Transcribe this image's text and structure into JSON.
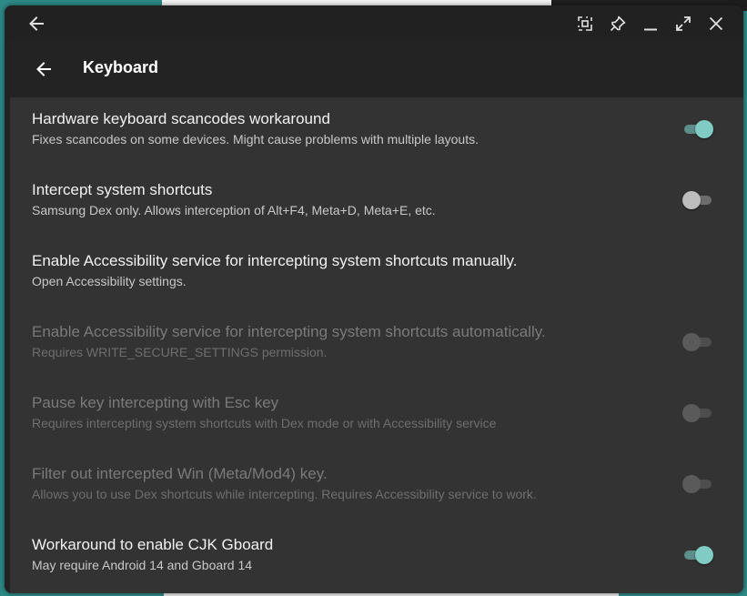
{
  "window": {
    "caption_buttons": [
      {
        "icon": "arrow-back-icon"
      },
      {
        "icon": "screenshot-select-icon"
      },
      {
        "icon": "pin-icon"
      },
      {
        "icon": "minimize-icon"
      },
      {
        "icon": "maximize-icon"
      },
      {
        "icon": "close-icon"
      }
    ]
  },
  "appbar": {
    "back_icon": "arrow-back-icon",
    "title": "Keyboard"
  },
  "colors": {
    "accent": "#80cbc4",
    "background": "#333333",
    "appbar": "#232323"
  },
  "settings": [
    {
      "title": "Hardware keyboard scancodes workaround",
      "subtitle": "Fixes scancodes on some devices. Might cause problems with multiple layouts.",
      "toggle": "on",
      "enabled": true
    },
    {
      "title": "Intercept system shortcuts",
      "subtitle": "Samsung Dex only. Allows interception of Alt+F4, Meta+D, Meta+E, etc.",
      "toggle": "off",
      "enabled": true
    },
    {
      "title": "Enable Accessibility service for intercepting system shortcuts manually.",
      "subtitle": "Open Accessibility settings.",
      "toggle": null,
      "enabled": true
    },
    {
      "title": "Enable Accessibility service for intercepting system shortcuts automatically.",
      "subtitle": "Requires WRITE_SECURE_SETTINGS permission.",
      "toggle": "off",
      "enabled": false
    },
    {
      "title": "Pause key intercepting with Esc key",
      "subtitle": "Requires intercepting system shortcuts with Dex mode or with Accessibility service",
      "toggle": "off",
      "enabled": false
    },
    {
      "title": "Filter out intercepted Win (Meta/Mod4) key.",
      "subtitle": "Allows you to use Dex shortcuts while intercepting. Requires Accessibility service to work.",
      "toggle": "off",
      "enabled": false
    },
    {
      "title": "Workaround to enable CJK Gboard",
      "subtitle": "May require Android 14 and Gboard 14",
      "toggle": "on",
      "enabled": true
    }
  ]
}
